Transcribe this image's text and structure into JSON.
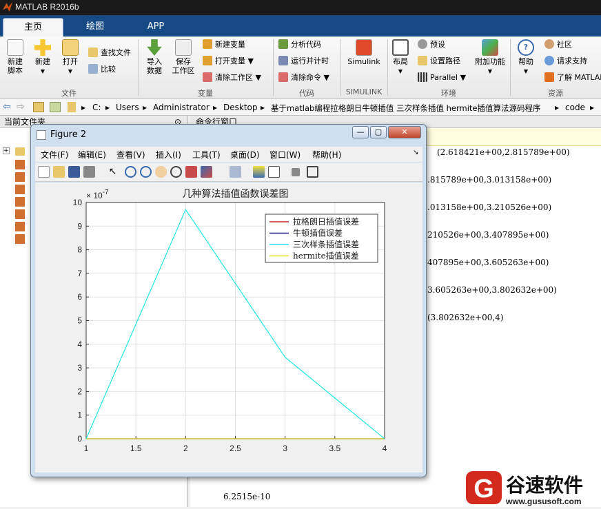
{
  "app": {
    "title": "MATLAB R2016b"
  },
  "tabs": [
    "主页",
    "绘图",
    "APP"
  ],
  "ribbon": {
    "file": {
      "new_script": "新建\n脚本",
      "new": "新建",
      "open": "打开",
      "find_files": "查找文件",
      "compare": "比较",
      "group": "文件"
    },
    "variable": {
      "import": "导入\n数据",
      "save_ws": "保存\n工作区",
      "new_var": "新建变量",
      "open_var": "打开变量",
      "clear_ws": "清除工作区",
      "group": "变量"
    },
    "code": {
      "analyze": "分析代码",
      "run_time": "运行并计时",
      "clear_cmd": "清除命令",
      "group": "代码"
    },
    "simulink": {
      "label": "Simulink",
      "group": "SIMULINK"
    },
    "env": {
      "layout": "布局",
      "prefs": "预设",
      "set_path": "设置路径",
      "parallel": "Parallel",
      "addons": "附加功能",
      "group": "环境"
    },
    "resources": {
      "help": "帮助",
      "community": "社区",
      "support": "请求支持",
      "learn": "了解 MATLAB",
      "group": "资源"
    }
  },
  "address": {
    "segments": [
      "C:",
      "Users",
      "Administrator",
      "Desktop",
      "基于matlab编程拉格朗日牛顿插值 三次样条插值 hermite插值算法源码程序",
      "code"
    ]
  },
  "panels": {
    "current_folder": "当前文件夹",
    "command_window": "命令行窗口"
  },
  "command_window": {
    "lines": [
      "(2.618421e+00,2.815789e+00)",
      ".815789e+00,3.013158e+00)",
      ".013158e+00,3.210526e+00)",
      "210526e+00,3.407895e+00)",
      "407895e+00,3.605263e+00)",
      "3.605263e+00,3.802632e+00)",
      "(3.802632e+00,4)",
      "6.2515e-10"
    ]
  },
  "figure": {
    "title": "Figure 2",
    "menu": [
      "文件(F)",
      "编辑(E)",
      "查看(V)",
      "插入(I)",
      "工具(T)",
      "桌面(D)",
      "窗口(W)",
      "帮助(H)"
    ]
  },
  "watermark": {
    "brand": "谷速软件",
    "url": "www.gususoft.com"
  },
  "chart_data": {
    "type": "line",
    "title": "几种算法插值函数误差图",
    "xlabel": "",
    "ylabel": "",
    "xlim": [
      1,
      4
    ],
    "ylim": [
      0,
      10
    ],
    "y_multiplier": "× 10^-7",
    "xticks": [
      "1",
      "1.5",
      "2",
      "2.5",
      "3",
      "3.5",
      "4"
    ],
    "yticks": [
      "0",
      "1",
      "2",
      "3",
      "4",
      "5",
      "6",
      "7",
      "8",
      "9",
      "10"
    ],
    "grid": true,
    "legend_position": "top-right",
    "series": [
      {
        "name": "拉格朗日插值误差",
        "color": "#cc2222",
        "x": [
          1,
          2,
          3,
          4
        ],
        "y": [
          0,
          0,
          0,
          0
        ]
      },
      {
        "name": "牛顿插值误差",
        "color": "#1a1a8c",
        "x": [
          1,
          2,
          3,
          4
        ],
        "y": [
          0,
          0,
          0,
          0
        ]
      },
      {
        "name": "三次样条插值误差",
        "color": "#22e5e5",
        "x": [
          1,
          2,
          3,
          4
        ],
        "y": [
          0,
          9.7,
          3.45,
          0
        ]
      },
      {
        "name": "hermite插值误差",
        "color": "#e6e61a",
        "x": [
          1,
          2,
          3,
          4
        ],
        "y": [
          0,
          0,
          0,
          0
        ]
      }
    ]
  }
}
